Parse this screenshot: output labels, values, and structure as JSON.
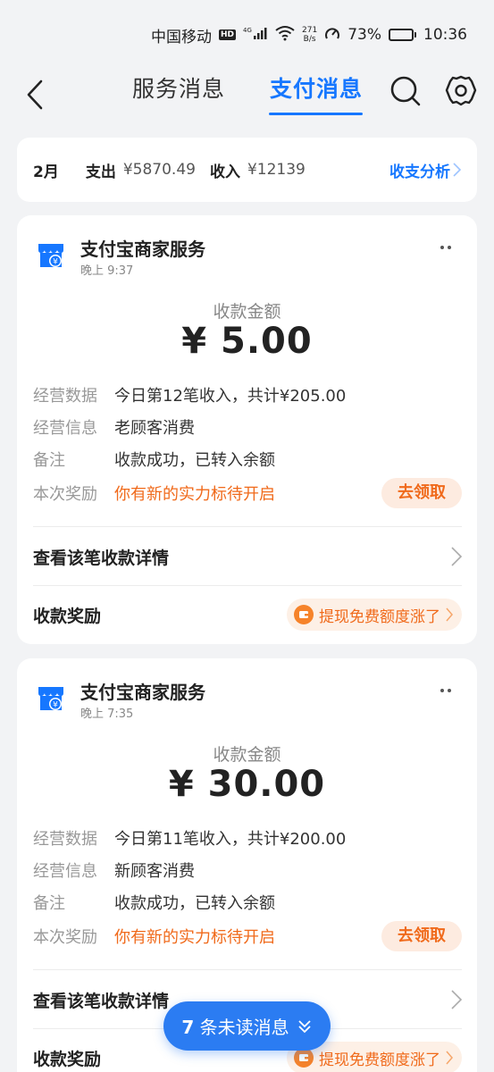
{
  "status_bar": {
    "carrier": "中国移动",
    "hd": "HD",
    "network": "4G",
    "speed_value": "271",
    "speed_unit": "B/s",
    "battery_percent": "73%",
    "battery_level": 0.73,
    "time": "10:36"
  },
  "header": {
    "tabs": [
      {
        "label": "服务消息",
        "active": false
      },
      {
        "label": "支付消息",
        "active": true
      }
    ]
  },
  "summary": {
    "month": "2月",
    "expense_label": "支出",
    "expense_value": "¥5870.49",
    "income_label": "收入",
    "income_value": "¥12139",
    "analysis_link": "收支分析"
  },
  "messages": [
    {
      "merchant": "支付宝商家服务",
      "time": "晚上 9:37",
      "amount_label": "收款金额",
      "amount": "¥ 5.00",
      "details": [
        {
          "key": "经营数据",
          "value": "今日第12笔收入，共计¥205.00"
        },
        {
          "key": "经营信息",
          "value": "老顾客消费"
        },
        {
          "key": "备注",
          "value": "收款成功，已转入余额"
        },
        {
          "key": "本次奖励",
          "value": "你有新的实力标待开启"
        }
      ],
      "claim_button": "去领取",
      "detail_link": "查看该笔收款详情",
      "reward_label": "收款奖励",
      "promo_text": "提现免费额度涨了"
    },
    {
      "merchant": "支付宝商家服务",
      "time": "晚上 7:35",
      "amount_label": "收款金额",
      "amount": "¥ 30.00",
      "details": [
        {
          "key": "经营数据",
          "value": "今日第11笔收入，共计¥200.00"
        },
        {
          "key": "经营信息",
          "value": "新顾客消费"
        },
        {
          "key": "备注",
          "value": "收款成功，已转入余额"
        },
        {
          "key": "本次奖励",
          "value": "你有新的实力标待开启"
        }
      ],
      "claim_button": "去领取",
      "detail_link": "查看该笔收款详情",
      "reward_label": "收款奖励",
      "promo_text": "提现免费额度涨了"
    }
  ],
  "unread": {
    "count": "7",
    "label": "条未读消息"
  },
  "colors": {
    "accent": "#1677ff",
    "orange": "#f06a1b",
    "background": "#f2f3f5"
  }
}
